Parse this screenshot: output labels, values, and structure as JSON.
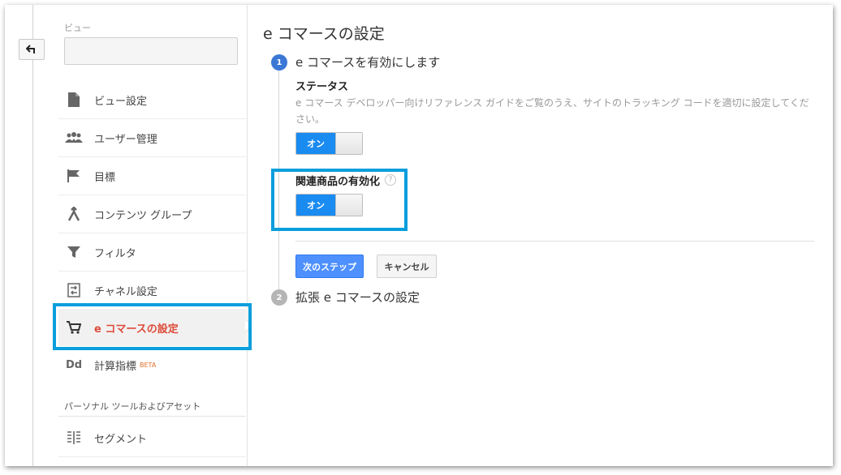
{
  "sidebar": {
    "view_label": "ビュー",
    "view_select_value": "",
    "items": [
      {
        "label": "ビュー設定",
        "icon": "document-icon"
      },
      {
        "label": "ユーザー管理",
        "icon": "users-icon"
      },
      {
        "label": "目標",
        "icon": "flag-icon"
      },
      {
        "label": "コンテンツ グループ",
        "icon": "content-group-icon"
      },
      {
        "label": "フィルタ",
        "icon": "filter-icon"
      },
      {
        "label": "チャネル設定",
        "icon": "channel-icon"
      },
      {
        "label": "e コマースの設定",
        "icon": "cart-icon"
      },
      {
        "label": "計算指標",
        "icon": "dd-icon",
        "badge": "BETA"
      }
    ],
    "section_title": "パーソナル ツールおよびアセット",
    "section_items": [
      {
        "label": "セグメント",
        "icon": "segment-icon"
      }
    ]
  },
  "main": {
    "title": "e コマースの設定",
    "step1": {
      "number": "1",
      "title": "e コマースを有効にします",
      "status_label": "ステータス",
      "description": "e コマース デベロッパー向けリファレンス ガイドをご覧のうえ、サイトのトラッキング コードを適切に設定してください。",
      "status_toggle": "オン",
      "related_label": "関連商品の有効化",
      "help": "?",
      "related_toggle": "オン"
    },
    "buttons": {
      "next": "次のステップ",
      "cancel": "キャンセル"
    },
    "step2": {
      "number": "2",
      "title": "拡張 e コマースの設定"
    }
  },
  "back_icon": "back-arrow-icon",
  "colors": {
    "accent_blue": "#1a8bf0",
    "highlight": "#0a9edc",
    "active_text": "#dd4b39",
    "button_blue": "#4d90fe"
  }
}
